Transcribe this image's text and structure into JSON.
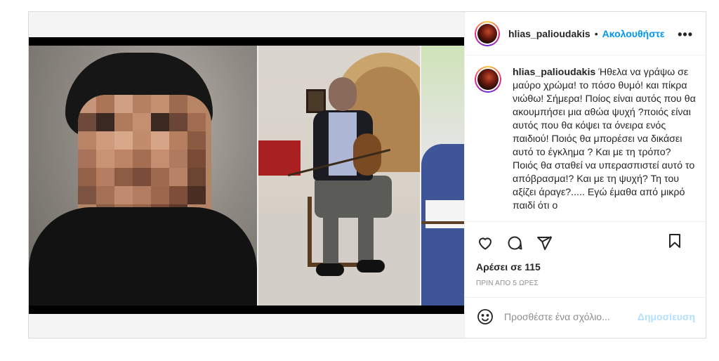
{
  "post": {
    "username": "hlias_palioudakis",
    "separator": "•",
    "follow_label": "Ακολουθήστε",
    "more_label": "•••",
    "caption": "Ήθελα να γράψω σε μαύρο χρώμα! το πόσο θυμό! και πίκρα νιώθω! Σήμερα! Ποίος είναι αυτός που θα ακουμπήσει μια αθώα ψυχή ?ποιός είναι αυτός που θα κόψει τα όνειρα ενός παιδιού! Ποιός θα μπορέσει να δικάσει αυτό το έγκλημα ? Και με τη τρόπο? Ποιός θα σταθεί να υπερασπιστεί αυτό το απόβρασμα!? Και με τη ψυχή? Τη του αξίζει άραγε?..... Εγώ έμαθα από μικρό παιδί ότι ο",
    "likes": "Αρέσει σε 115",
    "time": "ΠΡΙΝ ΑΠΟ 5 ΩΡΕΣ"
  },
  "comment": {
    "placeholder": "Προσθέστε ένα σχόλιο...",
    "publish_label": "Δημοσίευση"
  },
  "icons": {
    "like": "heart-icon",
    "comment": "comment-icon",
    "share": "send-icon",
    "save": "bookmark-icon",
    "emoji": "emoji-icon"
  },
  "colors": {
    "accent": "#0095f6",
    "publish_disabled": "#b2dffc",
    "text": "#262626",
    "muted": "#8e8e8e"
  }
}
